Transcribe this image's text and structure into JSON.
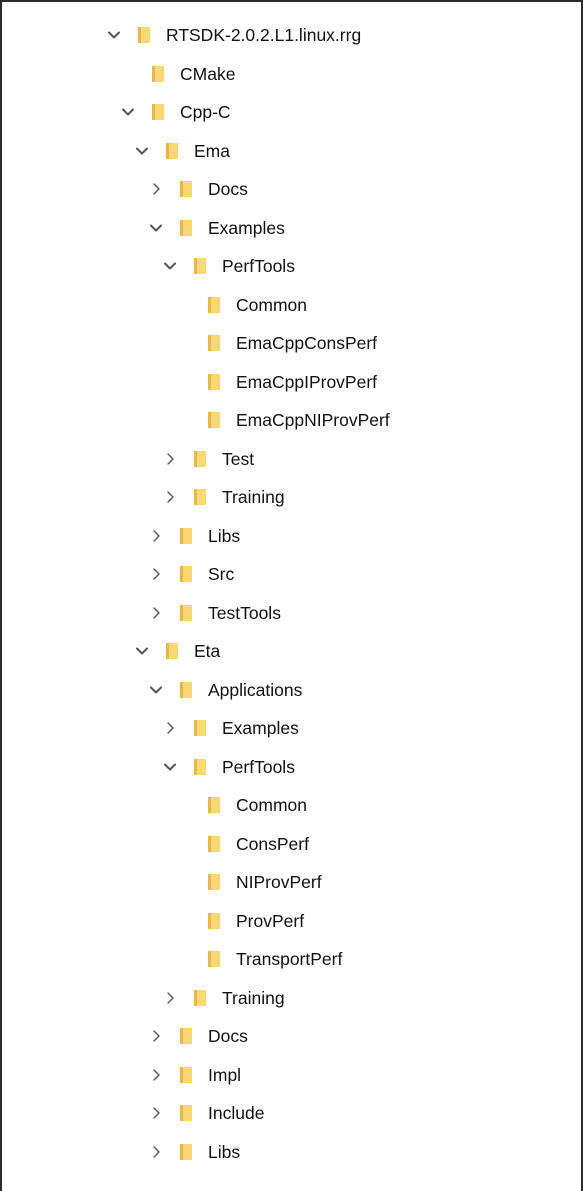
{
  "tree": {
    "items": [
      {
        "label": "RTSDK-2.0.2.L1.linux.rrg",
        "depth": 0,
        "state": "expanded"
      },
      {
        "label": "CMake",
        "depth": 1,
        "state": "leaf"
      },
      {
        "label": "Cpp-C",
        "depth": 1,
        "state": "expanded"
      },
      {
        "label": "Ema",
        "depth": 2,
        "state": "expanded"
      },
      {
        "label": "Docs",
        "depth": 3,
        "state": "collapsed"
      },
      {
        "label": "Examples",
        "depth": 3,
        "state": "expanded"
      },
      {
        "label": "PerfTools",
        "depth": 4,
        "state": "expanded"
      },
      {
        "label": "Common",
        "depth": 5,
        "state": "leaf"
      },
      {
        "label": "EmaCppConsPerf",
        "depth": 5,
        "state": "leaf"
      },
      {
        "label": "EmaCppIProvPerf",
        "depth": 5,
        "state": "leaf"
      },
      {
        "label": "EmaCppNIProvPerf",
        "depth": 5,
        "state": "leaf"
      },
      {
        "label": "Test",
        "depth": 4,
        "state": "collapsed"
      },
      {
        "label": "Training",
        "depth": 4,
        "state": "collapsed"
      },
      {
        "label": "Libs",
        "depth": 3,
        "state": "collapsed"
      },
      {
        "label": "Src",
        "depth": 3,
        "state": "collapsed"
      },
      {
        "label": "TestTools",
        "depth": 3,
        "state": "collapsed"
      },
      {
        "label": "Eta",
        "depth": 2,
        "state": "expanded"
      },
      {
        "label": "Applications",
        "depth": 3,
        "state": "expanded"
      },
      {
        "label": "Examples",
        "depth": 4,
        "state": "collapsed"
      },
      {
        "label": "PerfTools",
        "depth": 4,
        "state": "expanded"
      },
      {
        "label": "Common",
        "depth": 5,
        "state": "leaf"
      },
      {
        "label": "ConsPerf",
        "depth": 5,
        "state": "leaf"
      },
      {
        "label": "NIProvPerf",
        "depth": 5,
        "state": "leaf"
      },
      {
        "label": "ProvPerf",
        "depth": 5,
        "state": "leaf"
      },
      {
        "label": "TransportPerf",
        "depth": 5,
        "state": "leaf"
      },
      {
        "label": "Training",
        "depth": 4,
        "state": "collapsed"
      },
      {
        "label": "Docs",
        "depth": 3,
        "state": "collapsed"
      },
      {
        "label": "Impl",
        "depth": 3,
        "state": "collapsed"
      },
      {
        "label": "Include",
        "depth": 3,
        "state": "collapsed"
      },
      {
        "label": "Libs",
        "depth": 3,
        "state": "collapsed"
      }
    ]
  },
  "colors": {
    "folder_front": "#f8d775",
    "folder_back": "#e6b84a",
    "chevron": "#555555",
    "text": "#111111",
    "border": "#2b2b2b"
  },
  "icons": {
    "expanded": "chevron-down-icon",
    "collapsed": "chevron-right-icon",
    "folder": "folder-icon"
  }
}
